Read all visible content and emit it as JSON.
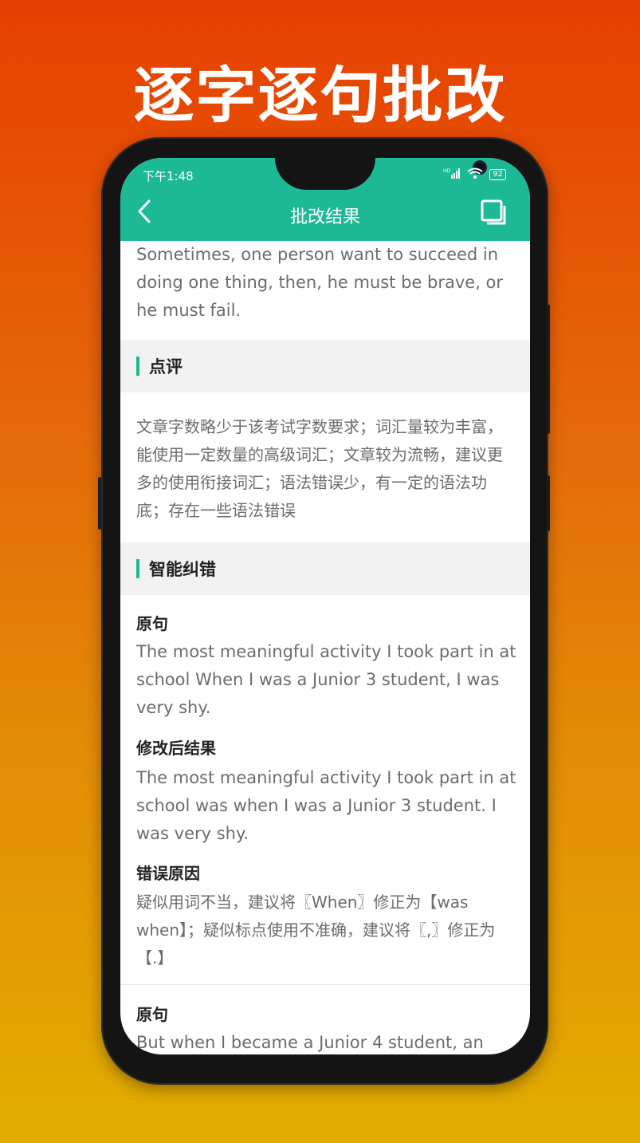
{
  "headline": "逐字逐句批改",
  "status_bar": {
    "time": "下午1:48",
    "signal": "HD",
    "battery": "92"
  },
  "app_bar": {
    "title": "批改结果"
  },
  "essay_excerpt": "Sometimes, one person want to succeed in doing one thing, then, he must be brave, or he must fail.",
  "review": {
    "heading": "点评",
    "text": "文章字数略少于该考试字数要求；词汇量较为丰富，能使用一定数量的高级词汇；文章较为流畅，建议更多的使用衔接词汇；语法错误少，有一定的语法功底；存在一些语法错误"
  },
  "corrections": {
    "heading": "智能纠错",
    "original_label": "原句",
    "revised_label": "修改后结果",
    "reason_label": "错误原因",
    "items": [
      {
        "original": "The most meaningful activity I took part in at school When I was a Junior 3 student, I was very shy.",
        "revised": "The most meaningful activity I took part in at school was when I was a Junior 3 student. I was very shy.",
        "reason": "疑似用词不当，建议将〖When〗修正为【was when】；疑似标点使用不准确，建议将〖,〗修正为【.】"
      },
      {
        "original": "But when I became a Junior 4 student, an"
      }
    ]
  }
}
